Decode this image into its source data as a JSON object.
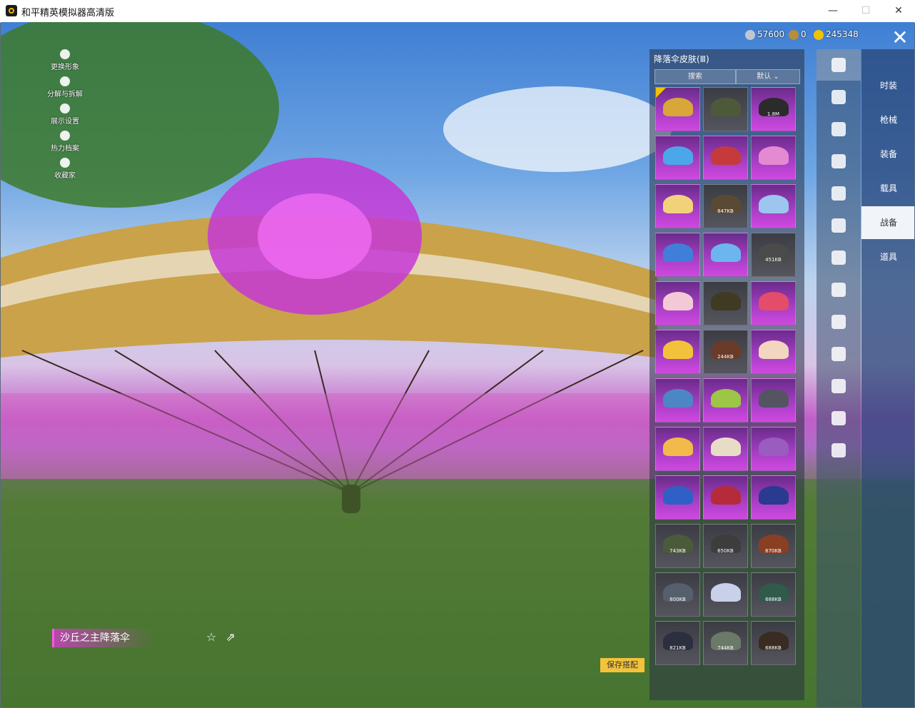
{
  "window": {
    "title": "和平精英模拟器高清版",
    "minimize": "—",
    "maximize": "☐",
    "close": "✕"
  },
  "currency": [
    {
      "icon": "silver-coin-icon",
      "value": "57600",
      "color": "#c0c6d0"
    },
    {
      "icon": "bronze-coin-icon",
      "value": "0",
      "color": "#b88d3c"
    },
    {
      "icon": "gold-coin-icon",
      "value": "245348",
      "color": "#f2c200"
    }
  ],
  "exit_symbol": "✕",
  "left_menu": [
    {
      "label": "更换形象",
      "icon": "person-icon"
    },
    {
      "label": "分解与拆解",
      "icon": "puzzle-icon"
    },
    {
      "label": "展示设置",
      "icon": "eye-icon"
    },
    {
      "label": "热力档案",
      "icon": "flame-icon"
    },
    {
      "label": "收藏家",
      "icon": "badge-icon"
    }
  ],
  "panel": {
    "title": "降落伞皮肤(Ⅲ)",
    "search_label": "搜索",
    "sort_label": "默认",
    "items": [
      {
        "size": "",
        "style": "purple",
        "color": "#d9a638",
        "selected": true
      },
      {
        "size": "",
        "style": "gray",
        "color": "#4d5a3a"
      },
      {
        "size": "1.8M",
        "style": "purple",
        "color": "#2b2b2b"
      },
      {
        "size": "",
        "style": "purple",
        "color": "#4ba7e8"
      },
      {
        "size": "",
        "style": "purple",
        "color": "#c53b3b"
      },
      {
        "size": "",
        "style": "purple",
        "color": "#e48ad0"
      },
      {
        "size": "",
        "style": "purple",
        "color": "#f1d27a"
      },
      {
        "size": "847KB",
        "style": "gray",
        "color": "#5b4a33"
      },
      {
        "size": "",
        "style": "purple",
        "color": "#9cc6ef"
      },
      {
        "size": "",
        "style": "purple",
        "color": "#3f7fd9"
      },
      {
        "size": "",
        "style": "purple",
        "color": "#6db5ef"
      },
      {
        "size": "451KB",
        "style": "gray",
        "color": "#4b4b4b"
      },
      {
        "size": "",
        "style": "purple",
        "color": "#f4c9d6"
      },
      {
        "size": "",
        "style": "gray",
        "color": "#3f3a22"
      },
      {
        "size": "",
        "style": "purple",
        "color": "#e44c6a"
      },
      {
        "size": "",
        "style": "purple",
        "color": "#f3c23b"
      },
      {
        "size": "244KB",
        "style": "gray",
        "color": "#6a3b28"
      },
      {
        "size": "",
        "style": "purple",
        "color": "#f2d6bf"
      },
      {
        "size": "",
        "style": "purple",
        "color": "#4c86c4"
      },
      {
        "size": "",
        "style": "purple",
        "color": "#9dc546"
      },
      {
        "size": "",
        "style": "purple",
        "color": "#545463"
      },
      {
        "size": "",
        "style": "purple",
        "color": "#f2b94b"
      },
      {
        "size": "",
        "style": "purple",
        "color": "#e8dcc7"
      },
      {
        "size": "",
        "style": "purple",
        "color": "#9a5cbf"
      },
      {
        "size": "",
        "style": "purple",
        "color": "#3060c5"
      },
      {
        "size": "",
        "style": "purple",
        "color": "#b52b39"
      },
      {
        "size": "",
        "style": "purple",
        "color": "#2a3a8e"
      },
      {
        "size": "743KB",
        "style": "gray",
        "color": "#4a5a3a"
      },
      {
        "size": "650KB",
        "style": "gray",
        "color": "#3d3d3d"
      },
      {
        "size": "670KB",
        "style": "gray",
        "color": "#8a3f22"
      },
      {
        "size": "800KB",
        "style": "gray",
        "color": "#56606c"
      },
      {
        "size": "",
        "style": "gray",
        "color": "#c8d0ea"
      },
      {
        "size": "688KB",
        "style": "gray",
        "color": "#2f5a4c"
      },
      {
        "size": "821KB",
        "style": "gray",
        "color": "#2b2f3e"
      },
      {
        "size": "744KB",
        "style": "gray",
        "color": "#6b7a68"
      },
      {
        "size": "688KB",
        "style": "gray",
        "color": "#3a2c22"
      }
    ]
  },
  "icon_tabs": [
    {
      "icon": "parachute-icon",
      "active": true
    },
    {
      "icon": "boat-icon"
    },
    {
      "icon": "plane-icon"
    },
    {
      "icon": "jet-icon"
    },
    {
      "icon": "emote-icon"
    },
    {
      "icon": "pet-icon"
    },
    {
      "icon": "speaker-icon"
    },
    {
      "icon": "card-icon"
    },
    {
      "icon": "image-icon"
    },
    {
      "icon": "spray-icon"
    },
    {
      "icon": "hand-icon"
    },
    {
      "icon": "wand-icon"
    },
    {
      "icon": "vehicle-icon"
    }
  ],
  "categories": [
    {
      "label": "时装"
    },
    {
      "label": "枪械"
    },
    {
      "label": "装备"
    },
    {
      "label": "载具"
    },
    {
      "label": "战备",
      "active": true
    },
    {
      "label": "道具"
    }
  ],
  "item_name": "沙丘之主降落伞",
  "favorite_symbol": "☆",
  "share_symbol": "⇗",
  "save_label": "保存搭配"
}
